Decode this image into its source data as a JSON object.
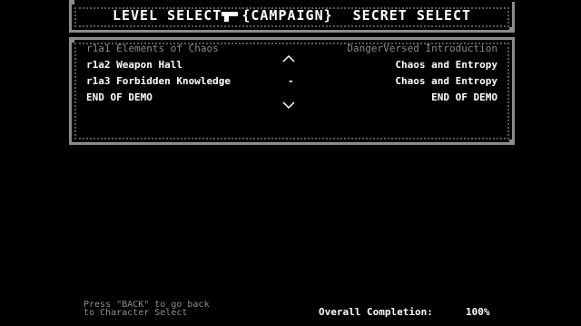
{
  "header": {
    "level_select": "LEVEL SELECT",
    "campaign": "{CAMPAIGN}",
    "secret_select": "SECRET SELECT"
  },
  "levels": [
    {
      "id": "r1a1",
      "name": "Elements of Chaos",
      "song": "DangerVersed Introduction",
      "selected": false
    },
    {
      "id": "r1a2",
      "name": "Weapon Hall",
      "song": "Chaos and Entropy",
      "selected": false
    },
    {
      "id": "r1a3",
      "name": "Forbidden Knowledge",
      "song": "Chaos and Entropy",
      "selected": true,
      "marker": "-"
    },
    {
      "id": "",
      "name": "END OF DEMO",
      "song": "END OF DEMO",
      "selected": false
    }
  ],
  "footer": {
    "back_line1": "Press \"BACK\" to go back",
    "back_line2": "to Character Select",
    "completion_label": "Overall Completion:",
    "completion_value": "100%"
  },
  "colors": {
    "background": "#000000",
    "frame": "#8c8c8c",
    "text": "#ffffff",
    "dim_text": "#8a8a8a"
  },
  "icons": [
    "pistol-icon",
    "chevron-up-icon",
    "chevron-down-icon"
  ]
}
